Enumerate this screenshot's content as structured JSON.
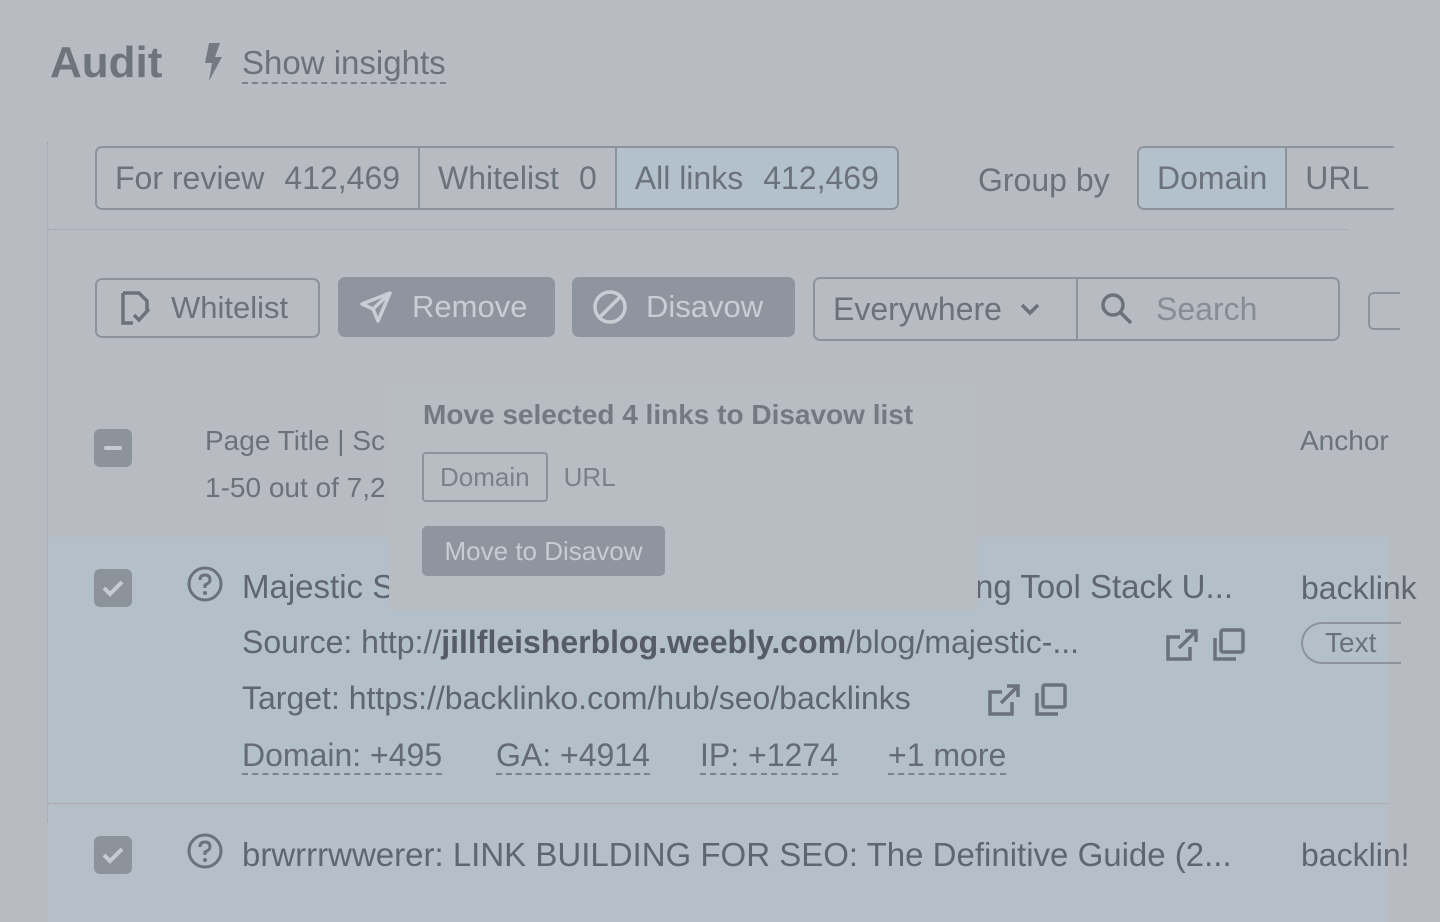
{
  "header": {
    "title": "Audit",
    "insights_label": "Show insights"
  },
  "filter_tabs": [
    {
      "label": "For review",
      "count": "412,469",
      "active": false
    },
    {
      "label": "Whitelist",
      "count": "0",
      "active": false
    },
    {
      "label": "All links",
      "count": "412,469",
      "active": true
    }
  ],
  "group_by": {
    "label": "Group by",
    "options": [
      {
        "label": "Domain",
        "active": true
      },
      {
        "label": "URL",
        "active": false
      }
    ]
  },
  "toolbar": {
    "whitelist_label": "Whitelist",
    "remove_label": "Remove",
    "disavow_label": "Disavow",
    "scope_value": "Everywhere",
    "search_placeholder": "Search"
  },
  "table": {
    "page_title_header": "Page Title | Sc",
    "range_text": "1-50 out of 7,2",
    "anchor_header": "Anchor",
    "rows": [
      {
        "title_left": "Majestic S",
        "title_right": "ng Tool Stack U...",
        "source_prefix": "Source: http://",
        "source_domain": "jillfleisherblog.weebly.com",
        "source_suffix": "/blog/majestic-...",
        "target": "Target: https://backlinko.com/hub/seo/backlinks",
        "metrics": [
          "Domain: +495",
          "GA: +4914",
          "IP: +1274",
          "+1 more"
        ],
        "anchor": "backlink",
        "anchor_type": "Text",
        "checked": true
      },
      {
        "title": "brwrrrwwerer: LINK BUILDING FOR SEO: The Definitive Guide (2...",
        "anchor": "backlin!",
        "checked": true
      }
    ]
  },
  "popup": {
    "title": "Move selected 4 links to Disavow list",
    "options": [
      "Domain",
      "URL"
    ],
    "button_label": "Move to Disavow"
  },
  "colors": {
    "background": "#b8bcc2",
    "selected_row": "#b3bfc9",
    "button_fill": "#8e959e"
  }
}
